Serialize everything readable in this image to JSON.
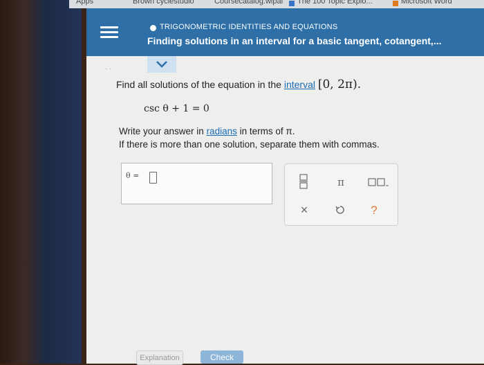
{
  "browser": {
    "bookmarks": [
      "Apps",
      "Brown cyclestudio",
      "Coursecatalog.wipal",
      "The 100 Topic Explo...",
      "Microsoft Word"
    ]
  },
  "header": {
    "topic": "TRIGONOMETRIC IDENTITIES AND EQUATIONS",
    "subtitle": "Finding solutions in an interval for a basic tangent, cotangent,...",
    "menu_icon": "hamburger-icon",
    "accent_color": "#2d6fa6"
  },
  "question": {
    "prompt_prefix": "Find all solutions of the equation in the",
    "interval_link": "interval",
    "interval_value": "[0, 2π).",
    "equation": "csc θ + 1 = 0",
    "instruction_1_prefix": "Write your answer in",
    "instruction_1_link": "radians",
    "instruction_1_suffix": "in terms of π.",
    "instruction_2": "If there is more than one solution, separate them with commas."
  },
  "answer": {
    "label": "θ =",
    "value": ""
  },
  "keypad": {
    "buttons": [
      "fraction-icon",
      "pi-icon",
      "ellipsis-pair-icon",
      "clear-icon",
      "undo-icon",
      "help-icon"
    ],
    "pi_symbol": "π",
    "help_symbol": "?",
    "clear_symbol": "×"
  },
  "footer": {
    "explanation_label": "Explanation",
    "check_label": "Check"
  }
}
